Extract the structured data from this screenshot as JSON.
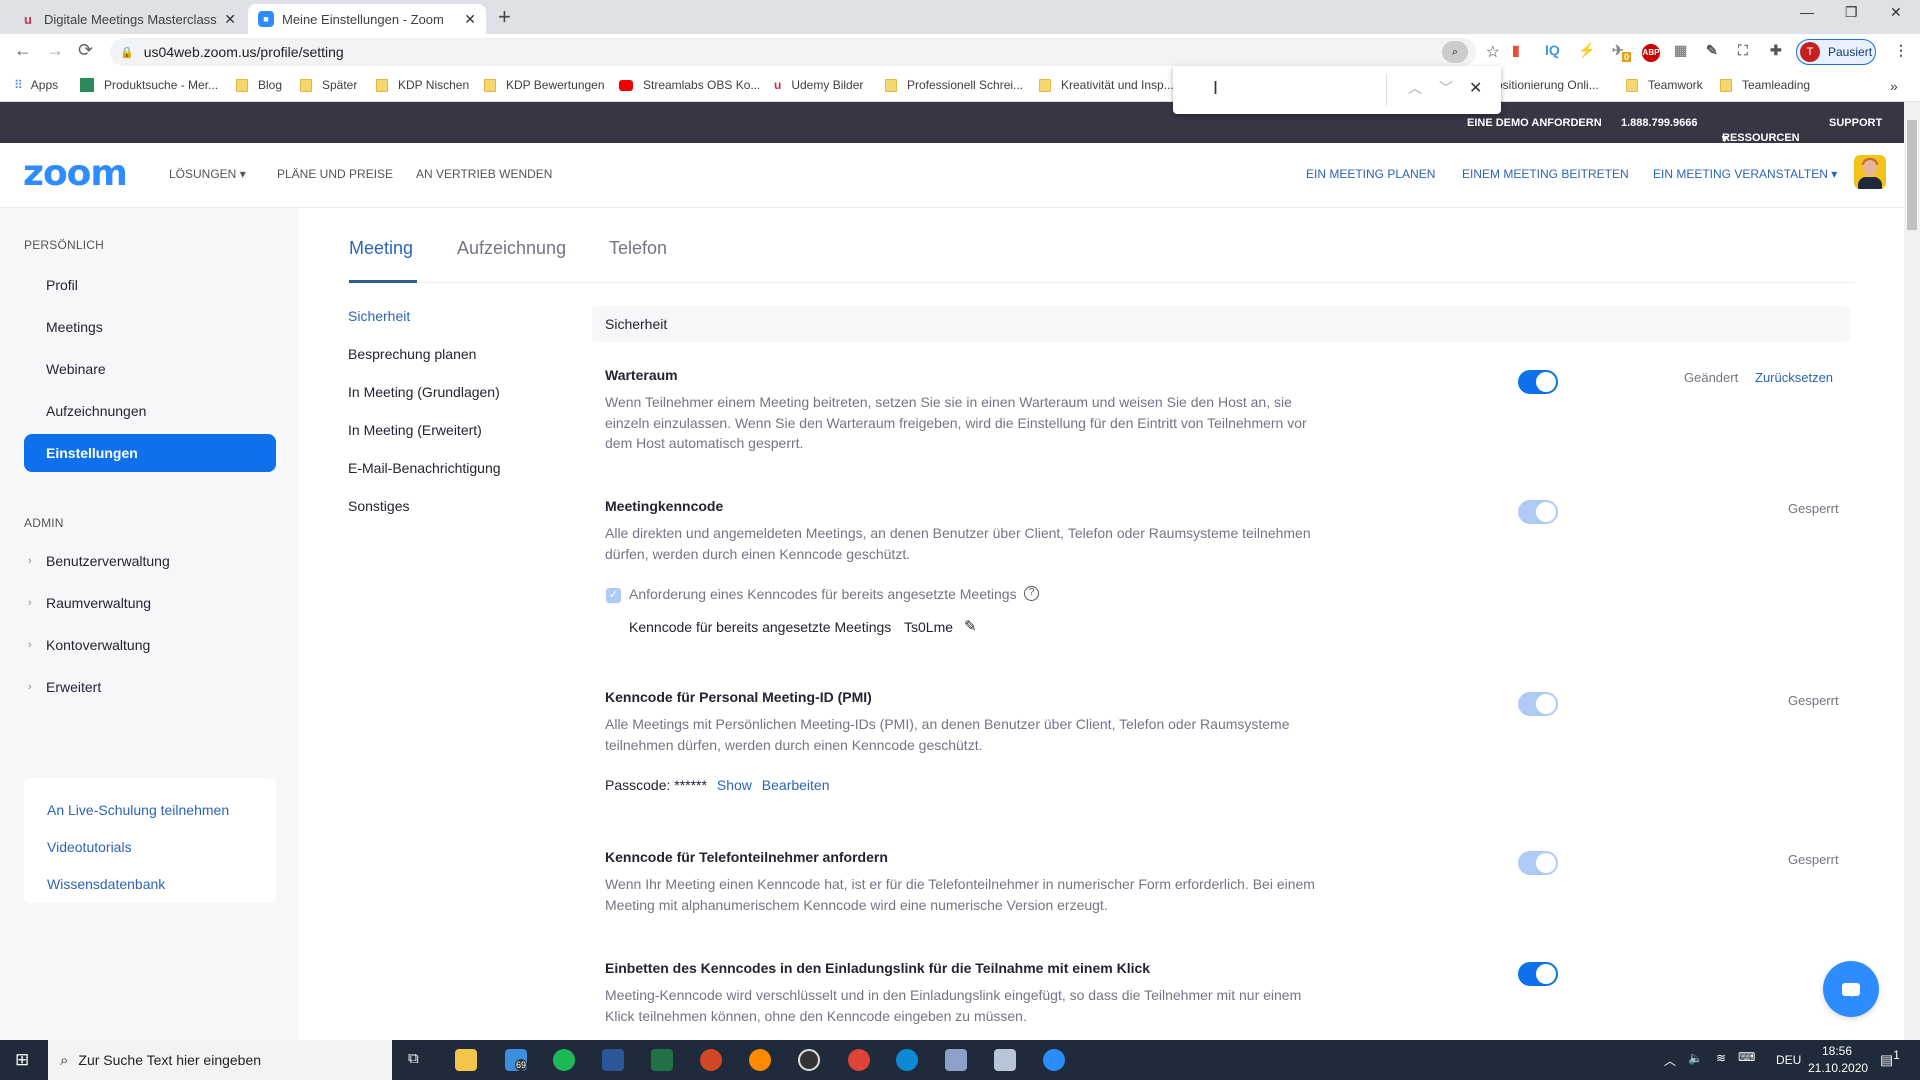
{
  "browser": {
    "tabs": [
      {
        "title": "Digitale Meetings Masterclass: Be",
        "icon": "udemy-icon",
        "active": false
      },
      {
        "title": "Meine Einstellungen - Zoom",
        "icon": "zoom-icon",
        "active": true
      }
    ],
    "url": "us04web.zoom.us/profile/setting",
    "profile_status": "Pausiert",
    "profile_initial": "T",
    "extensions": [
      "IQ",
      "ABP"
    ],
    "extension_badge": "0",
    "bookmarks": [
      {
        "label": "Apps",
        "icon": "apps-grid-icon"
      },
      {
        "label": "Produktsuche - Mer...",
        "icon": "shirt-icon"
      },
      {
        "label": "Blog",
        "icon": "folder-icon"
      },
      {
        "label": "Später",
        "icon": "folder-icon"
      },
      {
        "label": "KDP Nischen",
        "icon": "folder-icon"
      },
      {
        "label": "KDP Bewertungen",
        "icon": "folder-icon"
      },
      {
        "label": "Streamlabs OBS Ko...",
        "icon": "youtube-icon"
      },
      {
        "label": "Udemy Bilder",
        "icon": "udemy-icon"
      },
      {
        "label": "Professionell Schrei...",
        "icon": "folder-icon"
      },
      {
        "label": "Kreativität und Insp...",
        "icon": "folder-icon"
      },
      {
        "label": "ositionierung Onli...",
        "icon": "none"
      },
      {
        "label": "Teamwork",
        "icon": "folder-icon"
      },
      {
        "label": "Teamleading",
        "icon": "folder-icon"
      }
    ],
    "more_bookmarks": "»",
    "find_bar": {
      "value": ""
    }
  },
  "zoom_topbar": {
    "demo": "EINE DEMO ANFORDERN",
    "phone": "1.888.799.9666",
    "resources": "RESSOURCEN",
    "support": "SUPPORT"
  },
  "header": {
    "logo": "zoom",
    "nav": [
      "LÖSUNGEN",
      "PLÄNE UND PREISE",
      "AN VERTRIEB WENDEN"
    ],
    "actions": [
      "EIN MEETING PLANEN",
      "EINEM MEETING BEITRETEN",
      "EIN MEETING VERANSTALTEN"
    ]
  },
  "sidebar": {
    "personal_label": "PERSÖNLICH",
    "personal_items": [
      "Profil",
      "Meetings",
      "Webinare",
      "Aufzeichnungen",
      "Einstellungen"
    ],
    "active_item": "Einstellungen",
    "admin_label": "ADMIN",
    "admin_items": [
      "Benutzerverwaltung",
      "Raumverwaltung",
      "Kontoverwaltung",
      "Erweitert"
    ],
    "help_links": [
      "An Live-Schulung teilnehmen",
      "Videotutorials",
      "Wissensdatenbank"
    ]
  },
  "main": {
    "tabs": [
      "Meeting",
      "Aufzeichnung",
      "Telefon"
    ],
    "active_tab": "Meeting",
    "subnav": [
      "Sicherheit",
      "Besprechung planen",
      "In Meeting (Grundlagen)",
      "In Meeting (Erweitert)",
      "E-Mail-Benachrichtigung",
      "Sonstiges"
    ],
    "section_title": "Sicherheit",
    "settings": [
      {
        "title": "Warteraum",
        "description": "Wenn Teilnehmer einem Meeting beitreten, setzen Sie sie in einen Warteraum und weisen Sie den Host an, sie einzeln einzulassen. Wenn Sie den Warteraum freigeben, wird die Einstellung für den Eintritt von Teilnehmern vor dem Host automatisch gesperrt.",
        "enabled": true,
        "locked": false,
        "status": "Geändert",
        "action": "Zurücksetzen"
      },
      {
        "title": "Meetingkenncode",
        "description": "Alle direkten und angemeldeten Meetings, an denen Benutzer über Client, Telefon oder Raumsysteme teilnehmen dürfen, werden durch einen Kenncode geschützt.",
        "enabled": true,
        "locked": true,
        "status": "Gesperrt",
        "checkbox_label": "Anforderung eines Kenncodes für bereits angesetzte Meetings",
        "checkbox_checked": true,
        "passcode_label": "Kenncode für bereits angesetzte Meetings",
        "passcode_value": "Ts0Lme"
      },
      {
        "title": "Kenncode für Personal Meeting-ID (PMI)",
        "description": "Alle Meetings mit Persönlichen Meeting-IDs (PMI), an denen Benutzer über Client, Telefon oder Raumsysteme teilnehmen dürfen, werden durch einen Kenncode geschützt.",
        "enabled": true,
        "locked": true,
        "status": "Gesperrt",
        "passcode_label": "Passcode:",
        "passcode_masked": "******",
        "show_link": "Show",
        "edit_link": "Bearbeiten"
      },
      {
        "title": "Kenncode für Telefonteilnehmer anfordern",
        "description": "Wenn Ihr Meeting einen Kenncode hat, ist er für die Telefonteilnehmer in numerischer Form erforderlich. Bei einem Meeting mit alphanumerischem Kenncode wird eine numerische Version erzeugt.",
        "enabled": true,
        "locked": true,
        "status": "Gesperrt"
      },
      {
        "title": "Einbetten des Kenncodes in den Einladungslink für die Teilnahme mit einem Klick",
        "description": "Meeting-Kenncode wird verschlüsselt und in den Einladungslink eingefügt, so dass die Teilnehmer mit nur einem Klick teilnehmen können, ohne den Kenncode eingeben zu müssen.",
        "enabled": true,
        "locked": false
      }
    ]
  },
  "taskbar": {
    "search_placeholder": "Zur Suche Text hier eingeben",
    "mail_badge": "69",
    "language": "DEU",
    "time": "18:56",
    "date": "21.10.2020",
    "notification_count": "1"
  }
}
